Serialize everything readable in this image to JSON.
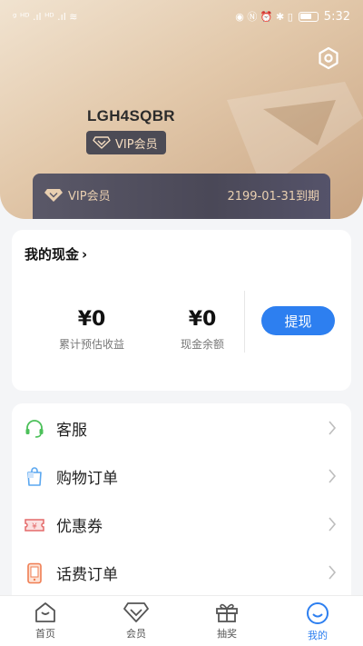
{
  "statusbar": {
    "time": "5:32",
    "left_glyphs": "ᵍ ᴴᴰ .ıl ᴴᴰ .ıl ≋",
    "right_glyphs": "◉ Ⓝ ⏰ ✱ ▯"
  },
  "profile": {
    "username": "LGH4SQBR",
    "vip_badge_label": "VIP会员"
  },
  "vip_card": {
    "label": "VIP会员",
    "expiry": "2199-01-31到期"
  },
  "cash": {
    "title": "我的现金",
    "title_arrow": "›",
    "stats": [
      {
        "amount": "¥0",
        "label": "累计预估收益"
      },
      {
        "amount": "¥0",
        "label": "现金余额"
      }
    ],
    "withdraw_label": "提现"
  },
  "menu": {
    "items": [
      {
        "label": "客服",
        "icon": "headset-icon"
      },
      {
        "label": "购物订单",
        "icon": "shopping-bag-icon"
      },
      {
        "label": "优惠券",
        "icon": "coupon-icon"
      },
      {
        "label": "话费订单",
        "icon": "phone-bill-icon"
      }
    ]
  },
  "nav": {
    "items": [
      {
        "label": "首页",
        "icon": "home-icon"
      },
      {
        "label": "会员",
        "icon": "diamond-icon"
      },
      {
        "label": "抽奖",
        "icon": "gift-icon"
      },
      {
        "label": "我的",
        "icon": "smile-icon",
        "active": true
      }
    ]
  },
  "colors": {
    "accent": "#2d7ff0",
    "vip_gold": "#e9cfb0",
    "vip_dark": "#4c4b55"
  }
}
